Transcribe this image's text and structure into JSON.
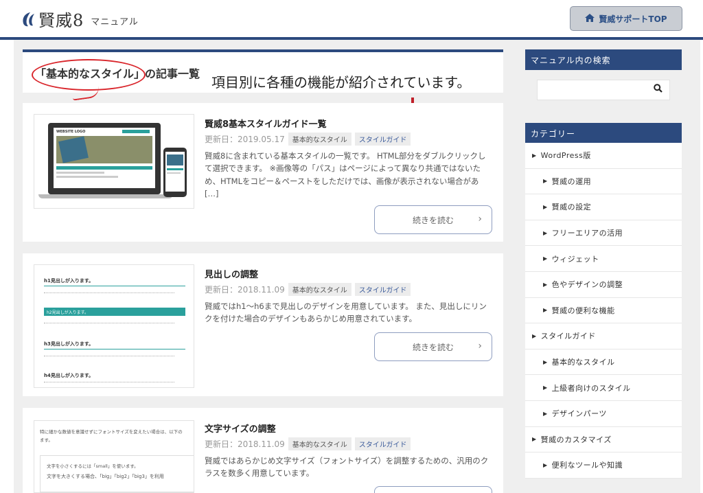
{
  "header": {
    "logo_text": "賢威8",
    "logo_sub": "マニュアル",
    "support_label": "賢威サポートTOP"
  },
  "main": {
    "list_title": "「基本的なスタイル」の記事一覧",
    "annotation": "項目別に各種の機能が紹介されています。",
    "more_label": "続きを読む",
    "articles": [
      {
        "title": "賢威8基本スタイルガイド一覧",
        "date": "更新日：2019.05.17",
        "tags": [
          "基本的なスタイル",
          "スタイルガイド"
        ],
        "excerpt": "賢威8に含まれている基本スタイルの一覧です。 HTML部分をダブルクリックして選択できます。 ※画像等の「パス」はページによって異なり共通ではないため、HTMLをコピー＆ペーストをしただけでは、画像が表示されない場合があ […]",
        "thumb_logo": "WEBSITE LOGO"
      },
      {
        "title": "見出しの調整",
        "date": "更新日：2018.11.09",
        "tags": [
          "基本的なスタイル",
          "スタイルガイド"
        ],
        "excerpt": "賢威ではh1～h6まで見出しのデザインを用意しています。 また、見出しにリンクを付けた場合のデザインもあらかじめ用意されています。",
        "thumb_lines": [
          "h1見出しが入ります。",
          "h2見出しが入ります。",
          "h3見出しが入ります。",
          "h4見出しが入ります。"
        ]
      },
      {
        "title": "文字サイズの調整",
        "date": "更新日：2018.11.09",
        "tags": [
          "基本的なスタイル",
          "スタイルガイド"
        ],
        "excerpt": "賢威ではあらかじめ文字サイズ（フォントサイズ）を調整するための、汎用のクラスを数多く用意しています。",
        "thumb_lines": [
          "特に細かな数値を意識せずにフォントサイズを変えたい場合は、以下の",
          "ます。",
          "文字を小さくするには「small」を使います。",
          "文字を大きくする場合、「big」「big2」「big3」を利用"
        ]
      }
    ]
  },
  "sidebar": {
    "search_title": "マニュアル内の検索",
    "search_placeholder": "",
    "category_title": "カテゴリー",
    "categories": [
      {
        "label": "WordPress版",
        "level": 1
      },
      {
        "label": "賢威の運用",
        "level": 2
      },
      {
        "label": "賢威の設定",
        "level": 2
      },
      {
        "label": "フリーエリアの活用",
        "level": 2
      },
      {
        "label": "ウィジェット",
        "level": 2
      },
      {
        "label": "色やデザインの調整",
        "level": 2
      },
      {
        "label": "賢威の便利な機能",
        "level": 2
      },
      {
        "label": "スタイルガイド",
        "level": 1
      },
      {
        "label": "基本的なスタイル",
        "level": 2
      },
      {
        "label": "上級者向けのスタイル",
        "level": 2
      },
      {
        "label": "デザインパーツ",
        "level": 2
      },
      {
        "label": "賢威のカスタマイズ",
        "level": 1
      },
      {
        "label": "便利なツールや知識",
        "level": 2
      }
    ]
  },
  "colors": {
    "accent": "#2c4a7e",
    "annotation_red": "#d9252b",
    "teal": "#2aa09c"
  }
}
